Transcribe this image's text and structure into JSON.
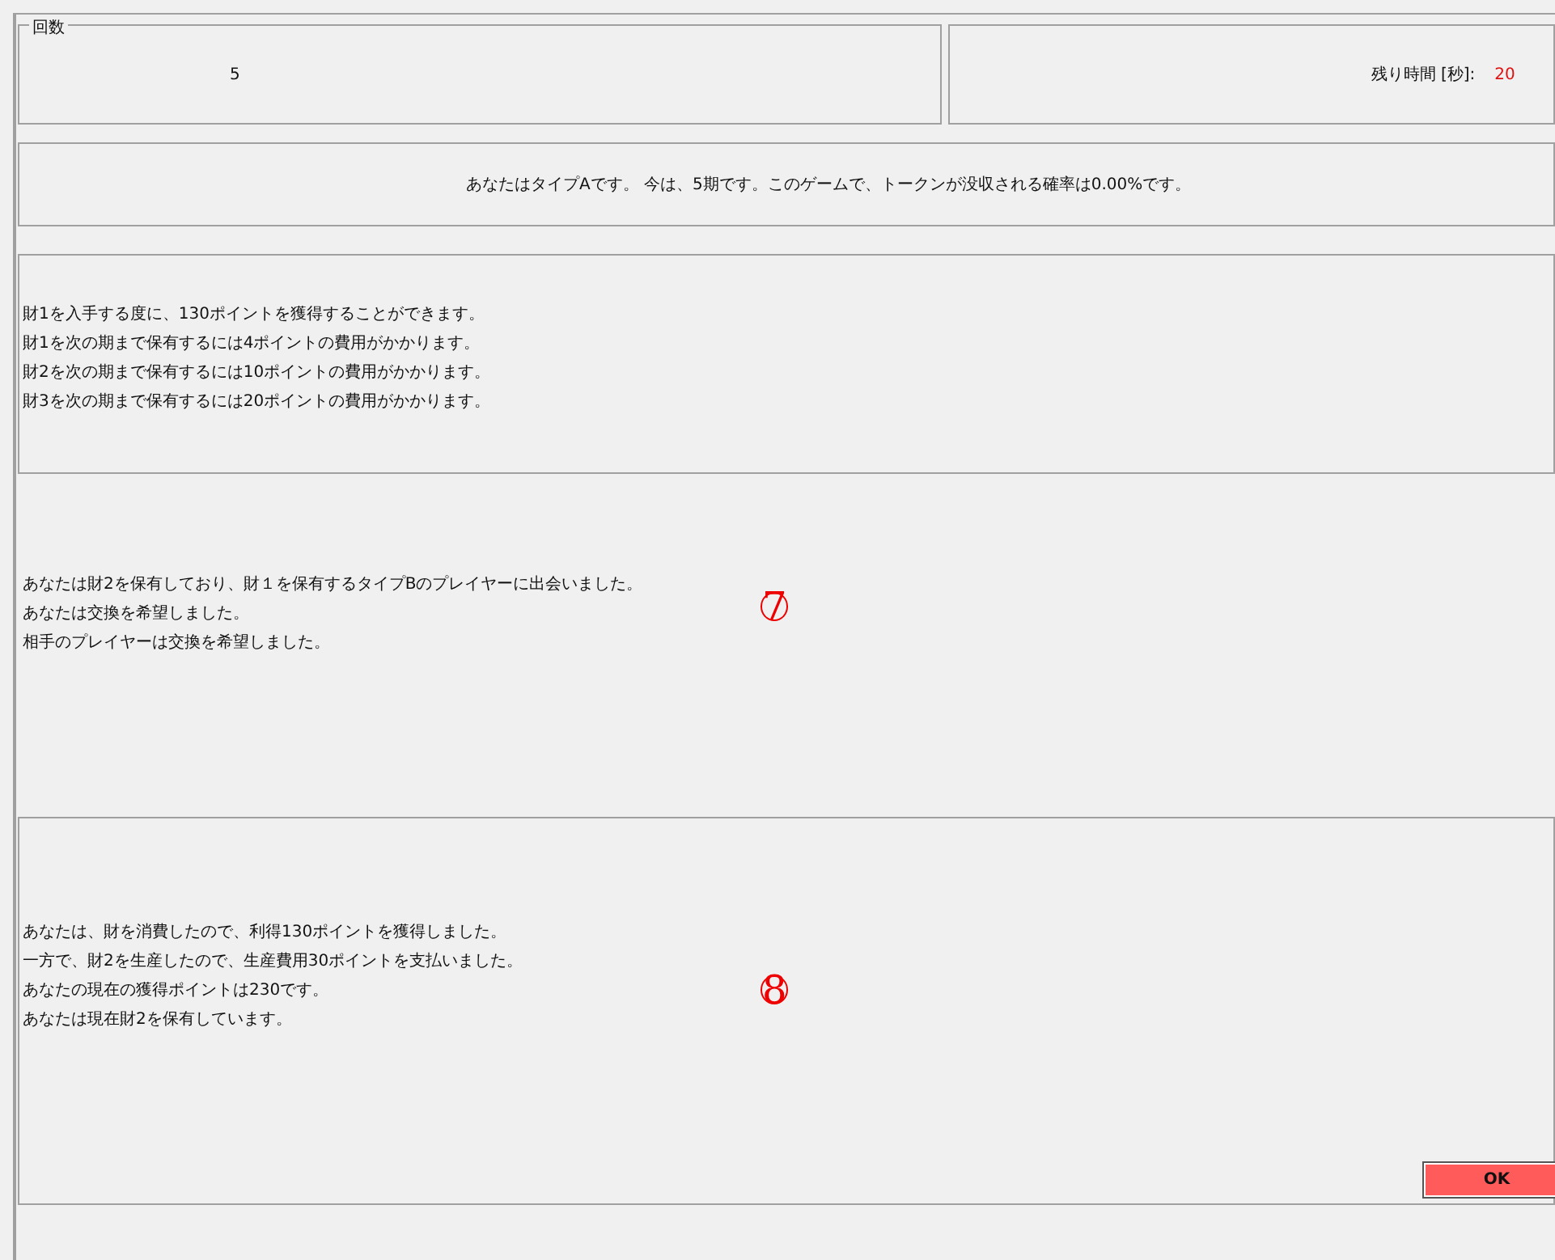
{
  "round_group": {
    "legend": "回数",
    "value": "5"
  },
  "timer": {
    "label": "残り時間 [秒]:",
    "value": "20"
  },
  "status_message": "あなたはタイプAです。 今は、5期です。このゲームで、トークンが没収される確率は0.00%です。",
  "rules_lines": [
    "財1を入手する度に、130ポイントを獲得することができます。",
    "財1を次の期まで保有するには4ポイントの費用がかかります。",
    "財2を次の期まで保有するには10ポイントの費用がかかります。",
    "財3を次の期まで保有するには20ポイントの費用がかかります。"
  ],
  "meeting": {
    "lines": [
      "あなたは財2を保有しており、財１を保有するタイプBのプレイヤーに出会いました。",
      "あなたは交換を希望しました。",
      "相手のプレイヤーは交換を希望しました。"
    ],
    "annotation": "7"
  },
  "result": {
    "lines": [
      "あなたは、財を消費したので、利得130ポイントを獲得しました。",
      "一方で、財2を生産したので、生産費用30ポイントを支払いました。",
      "あなたの現在の獲得ポイントは230です。",
      "あなたは現在財2を保有しています。"
    ],
    "annotation": "8"
  },
  "ok_button": "OK"
}
